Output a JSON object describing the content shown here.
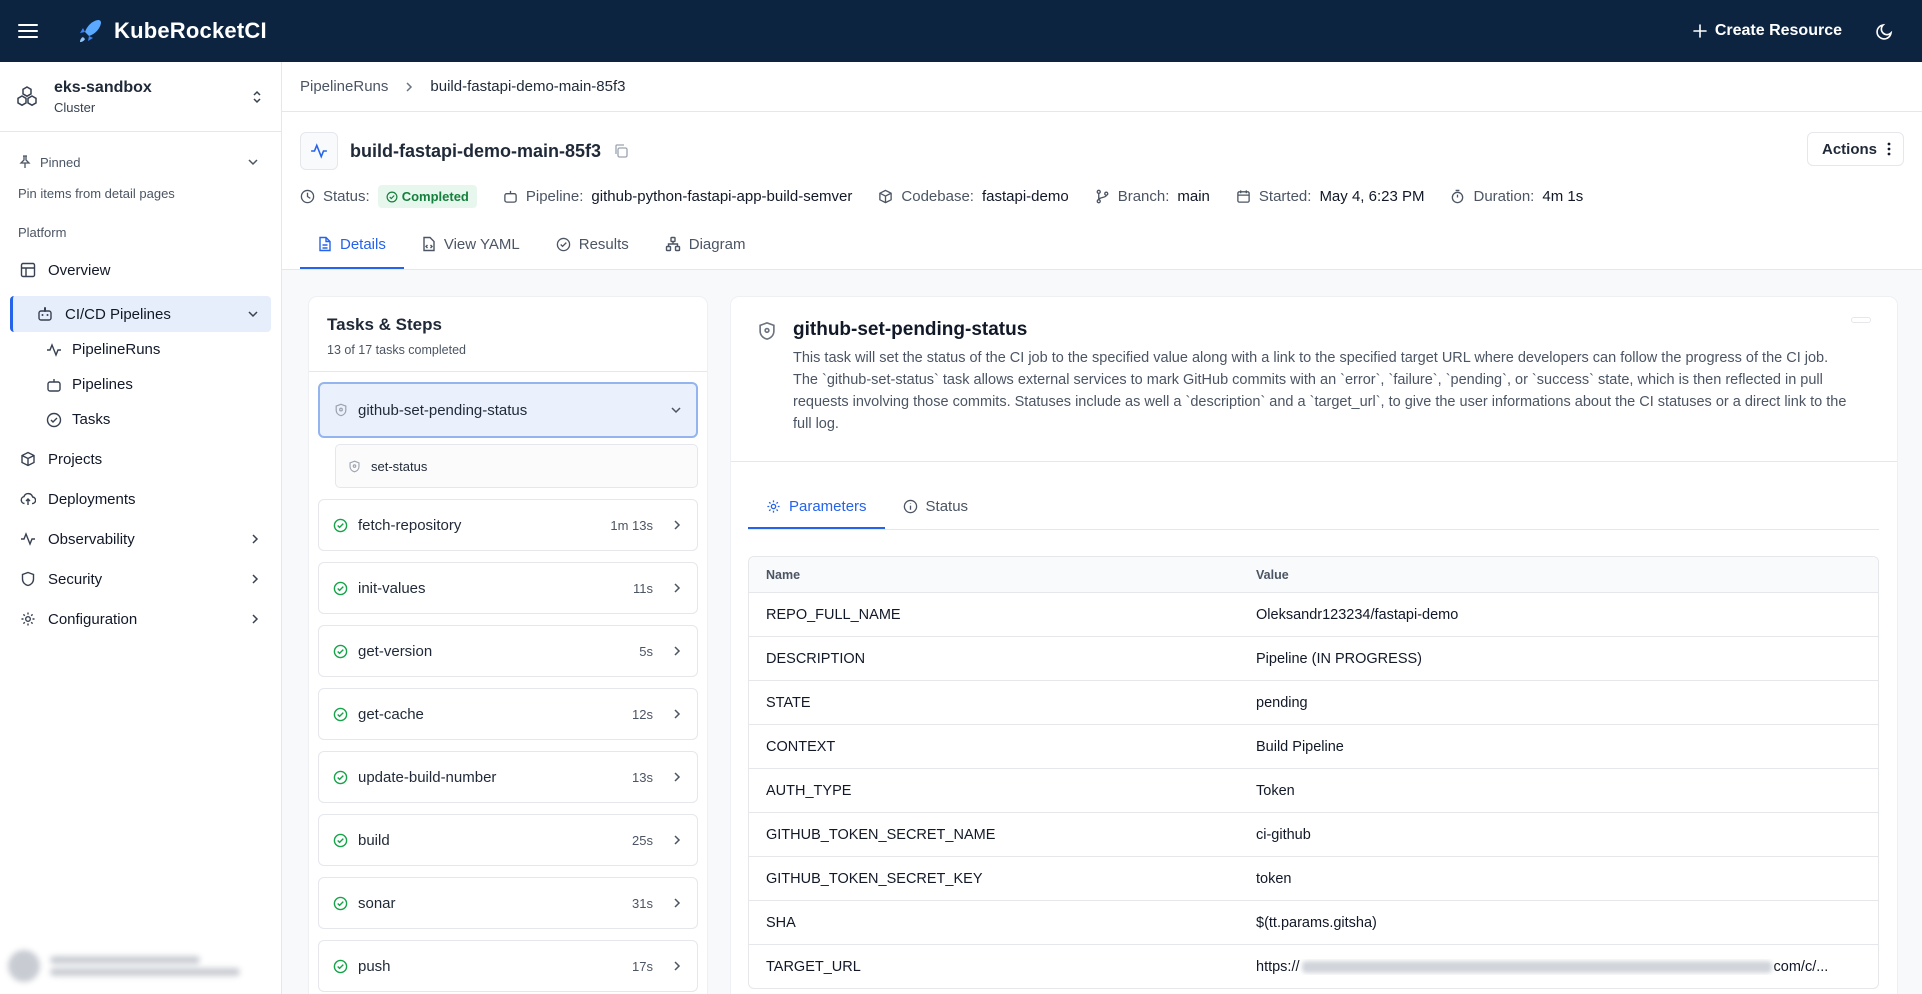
{
  "app": {
    "name": "KubeRocketCI",
    "create_label": "Create Resource"
  },
  "cluster": {
    "name": "eks-sandbox",
    "type": "Cluster"
  },
  "sidebar": {
    "pinned_label": "Pinned",
    "pinned_hint": "Pin items from detail pages",
    "section_label": "Platform",
    "overview": "Overview",
    "cicd": "CI/CD Pipelines",
    "cicd_children": [
      "PipelineRuns",
      "Pipelines",
      "Tasks"
    ],
    "projects": "Projects",
    "deployments": "Deployments",
    "observability": "Observability",
    "security": "Security",
    "configuration": "Configuration"
  },
  "breadcrumb": {
    "parent": "PipelineRuns",
    "current": "build-fastapi-demo-main-85f3"
  },
  "header": {
    "title": "build-fastapi-demo-main-85f3",
    "actions_label": "Actions",
    "status_label": "Status:",
    "status_value": "Completed",
    "pipeline_label": "Pipeline:",
    "pipeline_value": "github-python-fastapi-app-build-semver",
    "codebase_label": "Codebase:",
    "codebase_value": "fastapi-demo",
    "branch_label": "Branch:",
    "branch_value": "main",
    "started_label": "Started:",
    "started_value": "May 4, 6:23 PM",
    "duration_label": "Duration:",
    "duration_value": "4m 1s"
  },
  "tabs": [
    "Details",
    "View YAML",
    "Results",
    "Diagram"
  ],
  "tasks": {
    "title": "Tasks & Steps",
    "summary": "13 of 17 tasks completed",
    "selected": "github-set-pending-status",
    "step": "set-status",
    "items": [
      {
        "name": "fetch-repository",
        "duration": "1m 13s"
      },
      {
        "name": "init-values",
        "duration": "11s"
      },
      {
        "name": "get-version",
        "duration": "5s"
      },
      {
        "name": "get-cache",
        "duration": "12s"
      },
      {
        "name": "update-build-number",
        "duration": "13s"
      },
      {
        "name": "build",
        "duration": "25s"
      },
      {
        "name": "sonar",
        "duration": "31s"
      },
      {
        "name": "push",
        "duration": "17s"
      }
    ]
  },
  "detail": {
    "title": "github-set-pending-status",
    "description": "This task will set the status of the CI job to the specified value along with a link to the specified target URL where developers can follow the progress of the CI job. The `github-set-status` task allows external services to mark GitHub commits with an `error`, `failure`, `pending`, or `success` state, which is then reflected in pull requests involving those commits. Statuses include as well a `description` and a `target_url`, to give the user informations about the CI statuses or a direct link to the full log.",
    "subtabs": [
      "Parameters",
      "Status"
    ],
    "columns": [
      "Name",
      "Value"
    ],
    "params": [
      {
        "name": "REPO_FULL_NAME",
        "value": "Oleksandr123234/fastapi-demo"
      },
      {
        "name": "DESCRIPTION",
        "value": "Pipeline (IN PROGRESS)"
      },
      {
        "name": "STATE",
        "value": "pending"
      },
      {
        "name": "CONTEXT",
        "value": "Build Pipeline"
      },
      {
        "name": "AUTH_TYPE",
        "value": "Token"
      },
      {
        "name": "GITHUB_TOKEN_SECRET_NAME",
        "value": "ci-github"
      },
      {
        "name": "GITHUB_TOKEN_SECRET_KEY",
        "value": "token"
      },
      {
        "name": "SHA",
        "value": "$(tt.params.gitsha)"
      }
    ],
    "target_url": {
      "name": "TARGET_URL",
      "prefix": "https://",
      "suffix": "com/c/..."
    }
  }
}
